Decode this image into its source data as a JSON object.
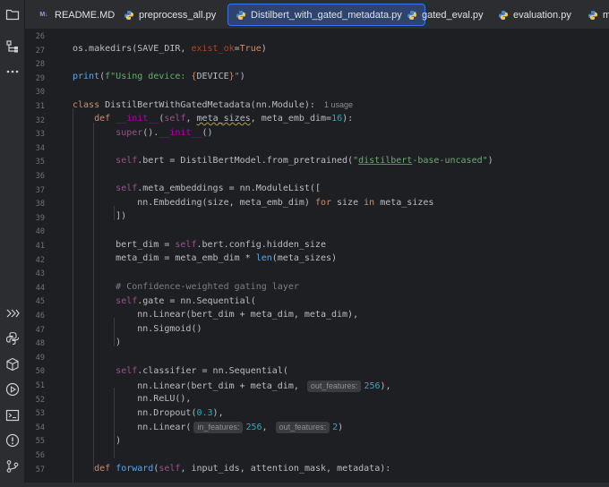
{
  "tabs": [
    {
      "label": "README.MD",
      "icon": "markdown-icon"
    },
    {
      "label": "preprocess_all.py",
      "icon": "python-icon"
    },
    {
      "label": "Distilbert_with_gated_metadata.py",
      "icon": "python-icon",
      "active": true
    },
    {
      "label": "gated_eval.py",
      "icon": "python-icon"
    },
    {
      "label": "evaluation.py",
      "icon": "python-icon"
    },
    {
      "label": "m",
      "icon": "python-icon"
    }
  ],
  "activity": {
    "top": [
      "folder-icon",
      "structure-icon",
      "more-icon"
    ],
    "bottom": [
      "services-icon",
      "python-console-icon",
      "packages-icon",
      "run-icon",
      "terminal-icon",
      "problems-icon",
      "git-icon"
    ]
  },
  "editor": {
    "line_numbers": [
      "26",
      "27",
      "28",
      "29",
      "30",
      "31",
      "32",
      "33",
      "34",
      "35",
      "36",
      "37",
      "38",
      "39",
      "40",
      "41",
      "42",
      "43",
      "44",
      "45",
      "46",
      "47",
      "48",
      "49",
      "50",
      "51",
      "52",
      "53",
      "54",
      "55",
      "56",
      "57"
    ],
    "usage_hint": "1 usage",
    "hints": {
      "out_features": "out_features:",
      "in_features": "in_features:"
    }
  },
  "colors": {
    "background": "#1e1f22",
    "keyword": "#cf8e6d",
    "self": "#94558d",
    "function": "#56a8f5",
    "number": "#2aacb8",
    "string": "#6aab73",
    "comment": "#7a7e85",
    "accent": "#3574f0"
  }
}
